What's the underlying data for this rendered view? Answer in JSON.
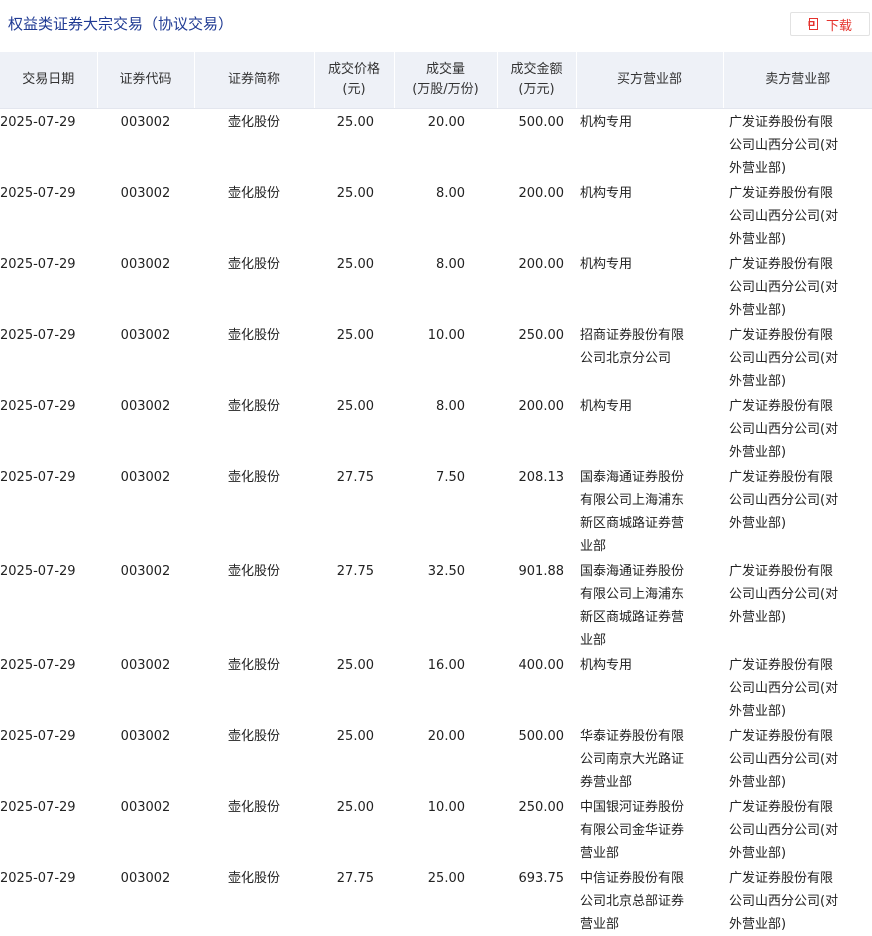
{
  "header": {
    "title": "权益类证券大宗交易（协议交易）",
    "download_label": "下载",
    "accent_color": "#e5322d",
    "title_color": "#1f3a93"
  },
  "table": {
    "columns": [
      {
        "key": "date",
        "lines": [
          "交易日期"
        ]
      },
      {
        "key": "code",
        "lines": [
          "证券代码"
        ]
      },
      {
        "key": "name",
        "lines": [
          "证券简称"
        ]
      },
      {
        "key": "price",
        "lines": [
          "成交价格",
          "(元)"
        ]
      },
      {
        "key": "volume",
        "lines": [
          "成交量",
          "(万股/万份)"
        ]
      },
      {
        "key": "amount",
        "lines": [
          "成交金额",
          "(万元)"
        ]
      },
      {
        "key": "buyer",
        "lines": [
          "买方营业部"
        ]
      },
      {
        "key": "seller",
        "lines": [
          "卖方营业部"
        ]
      }
    ],
    "rows": [
      {
        "date": "2025-07-29",
        "code": "003002",
        "name": "壶化股份",
        "price": "25.00",
        "volume": "20.00",
        "amount": "500.00",
        "buyer": "机构专用",
        "seller": "广发证券股份有限公司山西分公司(对外营业部)"
      },
      {
        "date": "2025-07-29",
        "code": "003002",
        "name": "壶化股份",
        "price": "25.00",
        "volume": "8.00",
        "amount": "200.00",
        "buyer": "机构专用",
        "seller": "广发证券股份有限公司山西分公司(对外营业部)"
      },
      {
        "date": "2025-07-29",
        "code": "003002",
        "name": "壶化股份",
        "price": "25.00",
        "volume": "8.00",
        "amount": "200.00",
        "buyer": "机构专用",
        "seller": "广发证券股份有限公司山西分公司(对外营业部)"
      },
      {
        "date": "2025-07-29",
        "code": "003002",
        "name": "壶化股份",
        "price": "25.00",
        "volume": "10.00",
        "amount": "250.00",
        "buyer": "招商证券股份有限公司北京分公司",
        "seller": "广发证券股份有限公司山西分公司(对外营业部)"
      },
      {
        "date": "2025-07-29",
        "code": "003002",
        "name": "壶化股份",
        "price": "25.00",
        "volume": "8.00",
        "amount": "200.00",
        "buyer": "机构专用",
        "seller": "广发证券股份有限公司山西分公司(对外营业部)"
      },
      {
        "date": "2025-07-29",
        "code": "003002",
        "name": "壶化股份",
        "price": "27.75",
        "volume": "7.50",
        "amount": "208.13",
        "buyer": "国泰海通证券股份有限公司上海浦东新区商城路证券营业部",
        "seller": "广发证券股份有限公司山西分公司(对外营业部)"
      },
      {
        "date": "2025-07-29",
        "code": "003002",
        "name": "壶化股份",
        "price": "27.75",
        "volume": "32.50",
        "amount": "901.88",
        "buyer": "国泰海通证券股份有限公司上海浦东新区商城路证券营业部",
        "seller": "广发证券股份有限公司山西分公司(对外营业部)"
      },
      {
        "date": "2025-07-29",
        "code": "003002",
        "name": "壶化股份",
        "price": "25.00",
        "volume": "16.00",
        "amount": "400.00",
        "buyer": "机构专用",
        "seller": "广发证券股份有限公司山西分公司(对外营业部)"
      },
      {
        "date": "2025-07-29",
        "code": "003002",
        "name": "壶化股份",
        "price": "25.00",
        "volume": "20.00",
        "amount": "500.00",
        "buyer": "华泰证券股份有限公司南京大光路证券营业部",
        "seller": "广发证券股份有限公司山西分公司(对外营业部)"
      },
      {
        "date": "2025-07-29",
        "code": "003002",
        "name": "壶化股份",
        "price": "25.00",
        "volume": "10.00",
        "amount": "250.00",
        "buyer": "中国银河证券股份有限公司金华证券营业部",
        "seller": "广发证券股份有限公司山西分公司(对外营业部)"
      },
      {
        "date": "2025-07-29",
        "code": "003002",
        "name": "壶化股份",
        "price": "27.75",
        "volume": "25.00",
        "amount": "693.75",
        "buyer": "中信证券股份有限公司北京总部证券营业部",
        "seller": "广发证券股份有限公司山西分公司(对外营业部)"
      }
    ]
  }
}
